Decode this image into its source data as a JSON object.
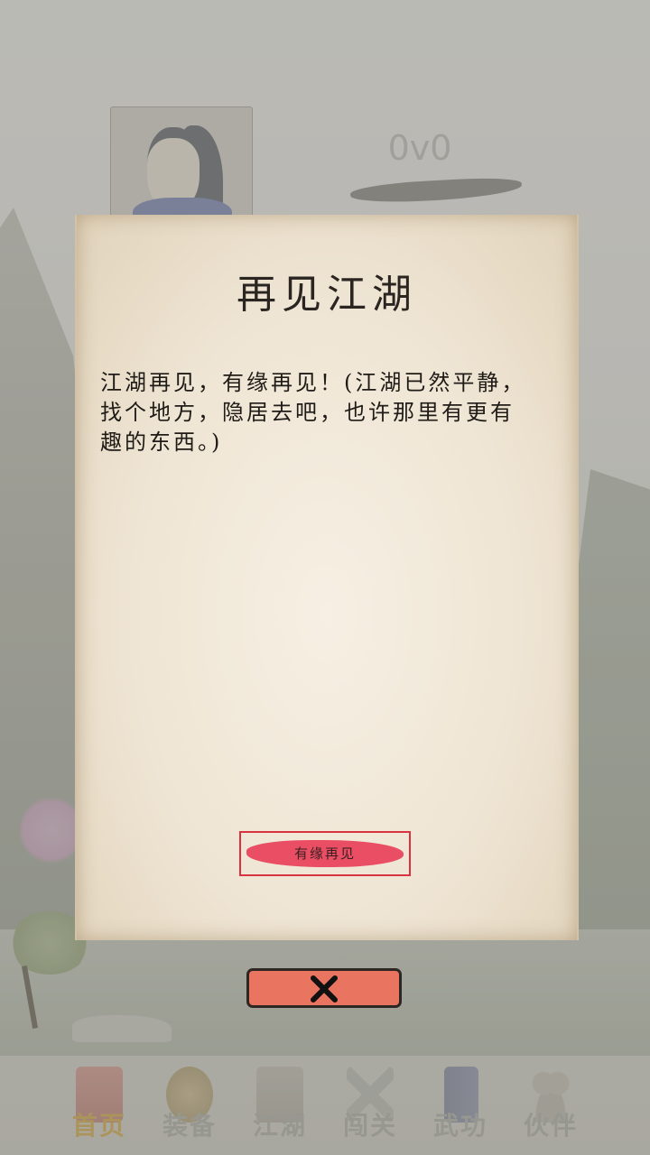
{
  "header": {
    "score": "0v0"
  },
  "dialog": {
    "title": "再见江湖",
    "message": "江湖再见，有缘再见！(江湖已然平静，找个地方，隐居去吧，也许那里有更有趣的东西。)",
    "confirm_label": "有缘再见"
  },
  "close_button": {
    "icon": "close-icon"
  },
  "bottom_nav": {
    "items": [
      {
        "label": "首页",
        "icon": "home-gate-icon",
        "active": true
      },
      {
        "label": "装备",
        "icon": "armor-icon",
        "active": false
      },
      {
        "label": "江湖",
        "icon": "jianghu-map-icon",
        "active": false
      },
      {
        "label": "闯关",
        "icon": "crossed-swords-icon",
        "active": false
      },
      {
        "label": "武功",
        "icon": "martial-book-icon",
        "active": false
      },
      {
        "label": "伙伴",
        "icon": "companions-icon",
        "active": false
      }
    ]
  },
  "colors": {
    "parchment": "#f2e9d9",
    "confirm_brush": "#e8415a",
    "close_bg": "#e9745f",
    "nav_active": "#b59a56"
  }
}
